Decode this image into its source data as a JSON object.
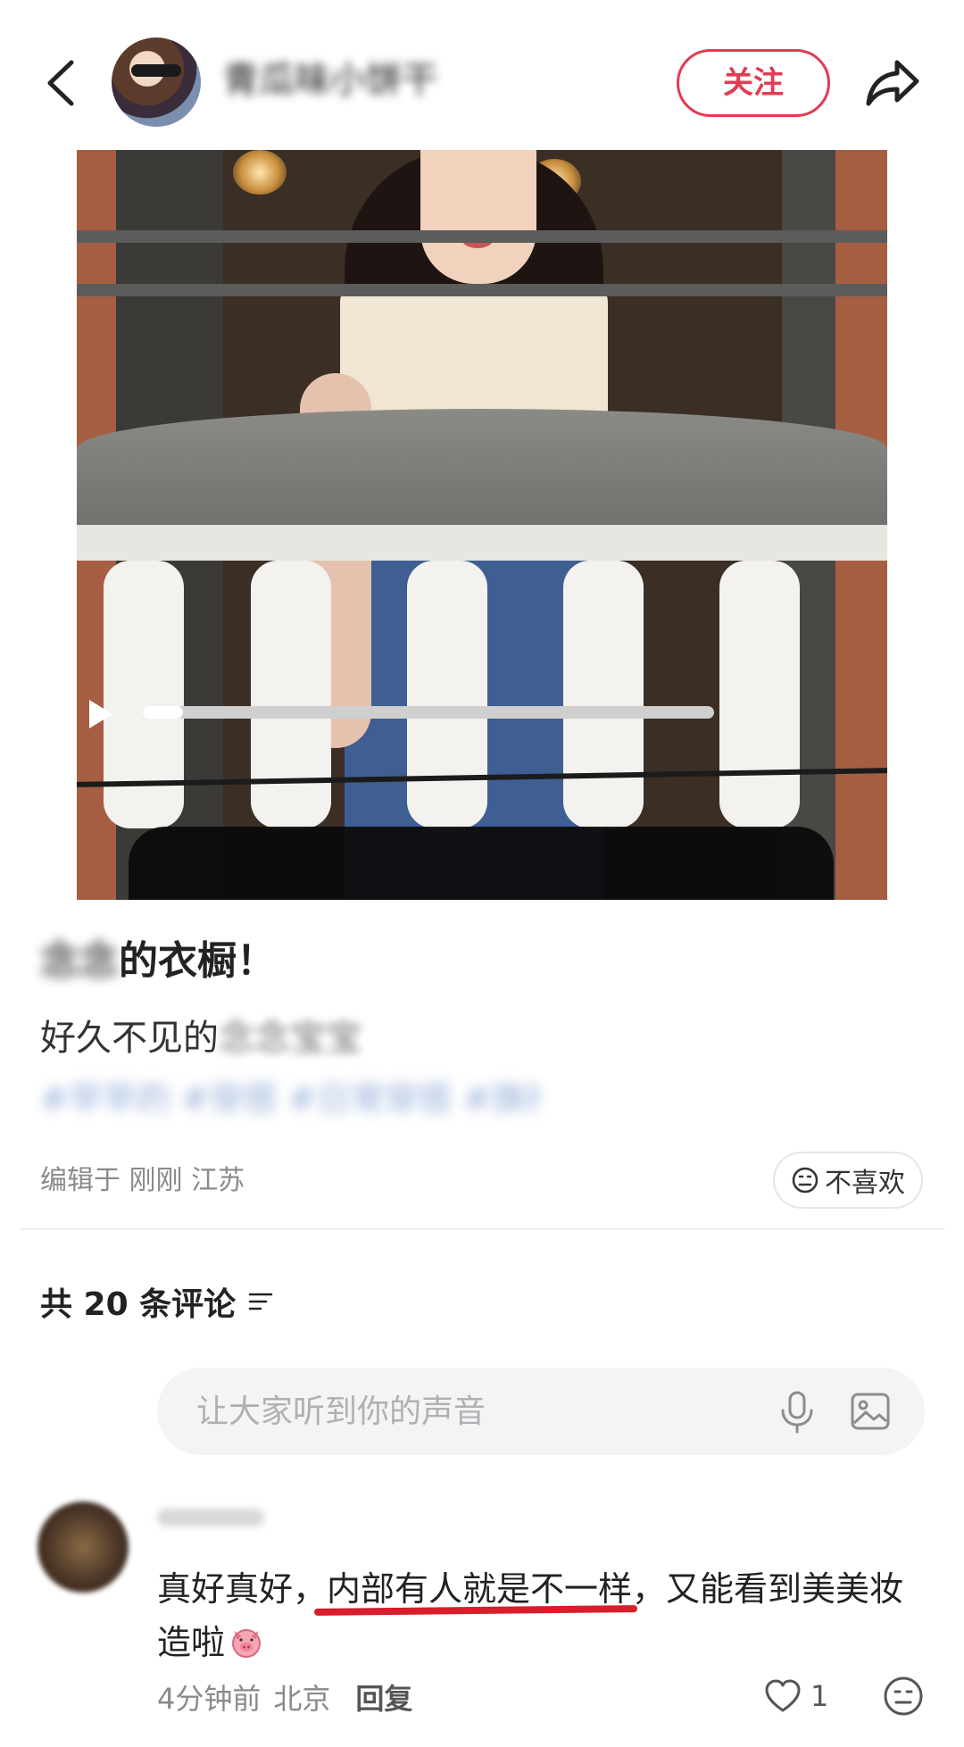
{
  "header": {
    "username": "青瓜味小饼干",
    "follow_label": "关注"
  },
  "video": {
    "progress": 0.07
  },
  "post": {
    "title_blurred": "念念",
    "title_clear": "的衣橱",
    "title_suffix": "！",
    "body_clear": "好久不见的",
    "body_blurred": "念念宝宝",
    "tags": "#早早的 #穿搭 #日常穿搭 #旗袍",
    "meta": "编辑于 刚刚 江苏",
    "dislike_label": "不喜欢"
  },
  "comments": {
    "count_label": "共 20 条评论",
    "input_placeholder": "让大家听到你的声音",
    "items": [
      {
        "text_before": "真好真好，",
        "text_highlight": "内部有人就是不一样",
        "text_after": "，又能看到美美妆造啦",
        "time": "4分钟前",
        "location": "北京",
        "reply_label": "回复",
        "likes": "1"
      }
    ]
  },
  "colors": {
    "accent": "#e03c52",
    "highlight_underline": "#d81e2b",
    "muted_text": "#8a8a8a"
  },
  "icons": [
    "back-arrow-icon",
    "share-icon",
    "play-icon",
    "dislike-face-icon",
    "sort-icon",
    "microphone-icon",
    "image-icon",
    "pig-emoji-icon",
    "heart-icon",
    "emoji-face-icon"
  ]
}
